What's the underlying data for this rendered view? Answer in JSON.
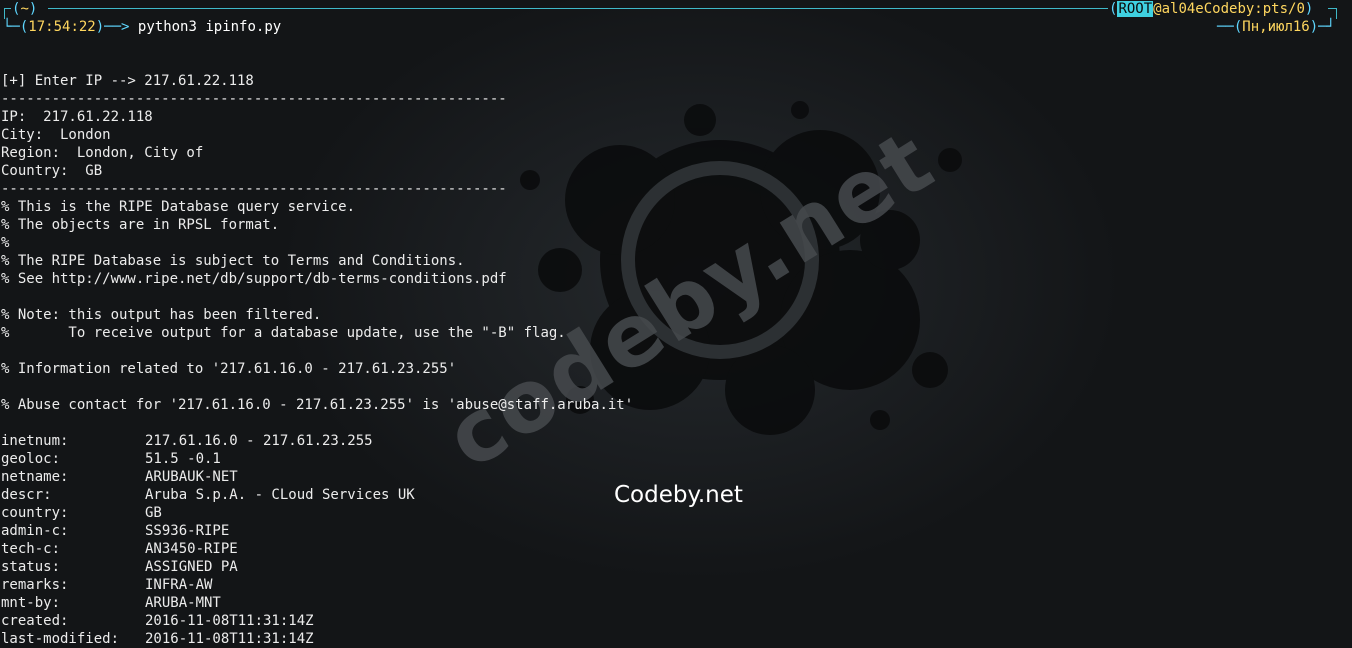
{
  "prompt": {
    "cwd": "~",
    "time": "17:54:22",
    "arrow": "──>",
    "command": "python3 ipinfo.py",
    "user_badge": "ROOT",
    "host": "@al04eCodeby:pts/0",
    "date": "Пн,июл16"
  },
  "output": {
    "enter_line": "[+] Enter IP --> 217.61.22.118",
    "separator": "------------------------------------------------------------",
    "summary": [
      "IP:  217.61.22.118",
      "City:  London",
      "Region:  London, City of",
      "Country:  GB"
    ],
    "comments": [
      "% This is the RIPE Database query service.",
      "% The objects are in RPSL format.",
      "%",
      "% The RIPE Database is subject to Terms and Conditions.",
      "% See http://www.ripe.net/db/support/db-terms-conditions.pdf",
      "",
      "% Note: this output has been filtered.",
      "%       To receive output for a database update, use the \"-B\" flag.",
      "",
      "% Information related to '217.61.16.0 - 217.61.23.255'",
      "",
      "% Abuse contact for '217.61.16.0 - 217.61.23.255' is 'abuse@staff.aruba.it'",
      ""
    ],
    "records": [
      {
        "key": "inetnum:",
        "value": "217.61.16.0 - 217.61.23.255"
      },
      {
        "key": "geoloc:",
        "value": "51.5 -0.1"
      },
      {
        "key": "netname:",
        "value": "ARUBAUK-NET"
      },
      {
        "key": "descr:",
        "value": "Aruba S.p.A. - CLoud Services UK"
      },
      {
        "key": "country:",
        "value": "GB"
      },
      {
        "key": "admin-c:",
        "value": "SS936-RIPE"
      },
      {
        "key": "tech-c:",
        "value": "AN3450-RIPE"
      },
      {
        "key": "status:",
        "value": "ASSIGNED PA"
      },
      {
        "key": "remarks:",
        "value": "INFRA-AW"
      },
      {
        "key": "mnt-by:",
        "value": "ARUBA-MNT"
      },
      {
        "key": "created:",
        "value": "2016-11-08T11:31:14Z"
      },
      {
        "key": "last-modified:",
        "value": "2016-11-08T11:31:14Z"
      }
    ]
  },
  "watermark": {
    "logo_text": "codeby.net",
    "caption": "Codeby.net"
  },
  "colors": {
    "prompt_accent": "#3fb8c8",
    "time_color": "#ffd75f",
    "badge_bg": "#3fd0e0"
  }
}
